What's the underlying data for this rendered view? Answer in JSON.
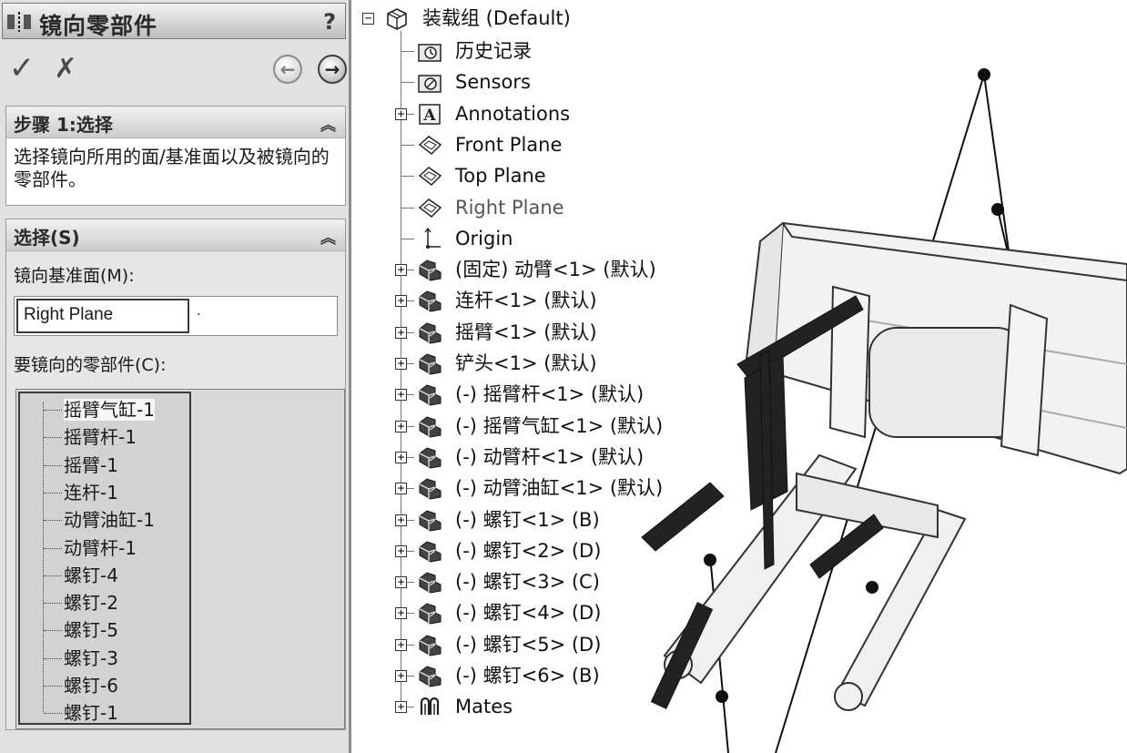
{
  "property_manager": {
    "title": "镜向零部件",
    "help": "?",
    "ok_icon": "checkmark-icon",
    "cancel_icon": "x-icon",
    "back_icon": "back-arrow-icon",
    "forward_icon": "forward-arrow-icon",
    "step_group": {
      "title": "步骤 1:选择",
      "message": "选择镜向所用的面/基准面以及被镜向的零部件。"
    },
    "selection_group": {
      "title": "选择(S)",
      "mirror_plane_label": "镜向基准面(M):",
      "mirror_plane_value": "Right Plane",
      "components_label": "要镜向的零部件(C):",
      "components": [
        "摇臂气缸-1",
        "摇臂杆-1",
        "摇臂-1",
        "连杆-1",
        "动臂油缸-1",
        "动臂杆-1",
        "螺钉-4",
        "螺钉-2",
        "螺钉-5",
        "螺钉-3",
        "螺钉-6",
        "螺钉-1"
      ]
    }
  },
  "tree": {
    "root": "装载组  (Default)",
    "items": [
      {
        "label": "历史记录",
        "icon": "history-folder-icon",
        "expander": false,
        "dim": false
      },
      {
        "label": "Sensors",
        "icon": "sensors-folder-icon",
        "expander": false,
        "dim": false
      },
      {
        "label": "Annotations",
        "icon": "annotations-icon",
        "expander": true,
        "dim": false
      },
      {
        "label": "Front Plane",
        "icon": "plane-icon",
        "expander": false,
        "dim": false
      },
      {
        "label": "Top Plane",
        "icon": "plane-icon",
        "expander": false,
        "dim": false
      },
      {
        "label": "Right Plane",
        "icon": "plane-icon",
        "expander": false,
        "dim": true
      },
      {
        "label": "Origin",
        "icon": "origin-icon",
        "expander": false,
        "dim": false
      },
      {
        "label": "(固定) 动臂<1> (默认)",
        "icon": "part-icon",
        "expander": true,
        "dim": false
      },
      {
        "label": "连杆<1> (默认)",
        "icon": "part-icon",
        "expander": true,
        "dim": false
      },
      {
        "label": "摇臂<1> (默认)",
        "icon": "part-icon",
        "expander": true,
        "dim": false
      },
      {
        "label": "铲头<1> (默认)",
        "icon": "part-icon",
        "expander": true,
        "dim": false
      },
      {
        "label": "(-) 摇臂杆<1> (默认)",
        "icon": "part-icon",
        "expander": true,
        "dim": false
      },
      {
        "label": "(-) 摇臂气缸<1> (默认)",
        "icon": "part-icon",
        "expander": true,
        "dim": false
      },
      {
        "label": "(-) 动臂杆<1> (默认)",
        "icon": "part-icon",
        "expander": true,
        "dim": false
      },
      {
        "label": "(-) 动臂油缸<1> (默认)",
        "icon": "part-icon",
        "expander": true,
        "dim": false
      },
      {
        "label": "(-) 螺钉<1> (B)",
        "icon": "part-icon",
        "expander": true,
        "dim": false
      },
      {
        "label": "(-) 螺钉<2> (D)",
        "icon": "part-icon",
        "expander": true,
        "dim": false
      },
      {
        "label": "(-) 螺钉<3> (C)",
        "icon": "part-icon",
        "expander": true,
        "dim": false
      },
      {
        "label": "(-) 螺钉<4> (D)",
        "icon": "part-icon",
        "expander": true,
        "dim": false
      },
      {
        "label": "(-) 螺钉<5> (D)",
        "icon": "part-icon",
        "expander": true,
        "dim": false
      },
      {
        "label": "(-) 螺钉<6> (B)",
        "icon": "part-icon",
        "expander": true,
        "dim": false
      },
      {
        "label": "Mates",
        "icon": "mates-icon",
        "expander": true,
        "dim": false
      }
    ]
  }
}
